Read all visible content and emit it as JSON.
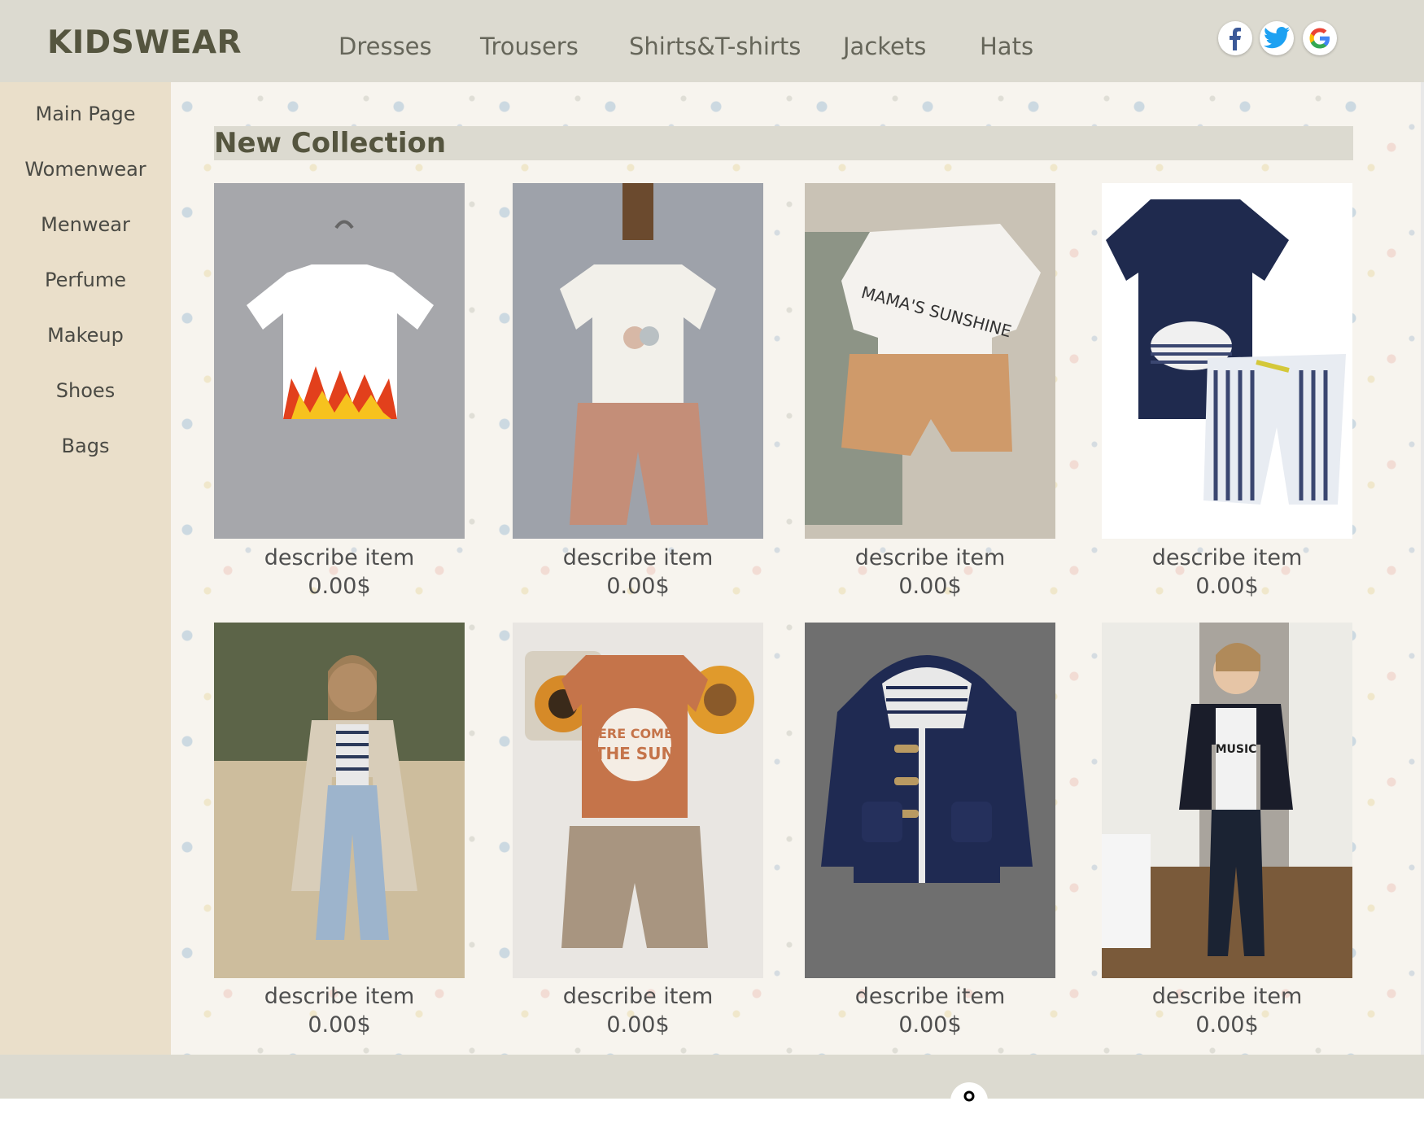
{
  "brand": "KIDSWEAR",
  "nav": [
    "Dresses",
    "Trousers",
    "Shirts&T-shirts",
    "Jackets",
    "Hats"
  ],
  "social": [
    {
      "icon": "facebook-icon",
      "glyph": "f",
      "color": "#3b5998"
    },
    {
      "icon": "twitter-icon",
      "glyph": "t",
      "color": "#1da1f2"
    },
    {
      "icon": "google-icon",
      "glyph": "G",
      "color": "#4285f4"
    }
  ],
  "sidebar": [
    "Main Page",
    "Womenwear",
    "Menwear",
    "Perfume",
    "Makeup",
    "Shoes",
    "Bags"
  ],
  "section_title": "New Collection",
  "products": [
    {
      "desc": "describe item",
      "price": "0.00$"
    },
    {
      "desc": "describe item",
      "price": "0.00$"
    },
    {
      "desc": "describe item",
      "price": "0.00$"
    },
    {
      "desc": "describe item",
      "price": "0.00$"
    },
    {
      "desc": "describe item",
      "price": "0.00$"
    },
    {
      "desc": "describe item",
      "price": "0.00$"
    },
    {
      "desc": "describe item",
      "price": "0.00$"
    },
    {
      "desc": "describe item",
      "price": "0.00$"
    }
  ],
  "product_images": [
    {
      "name": "flame-crop-tee-photo",
      "bg": "#a6a7ab",
      "garment": "#ffffff",
      "accent": "#e2401c"
    },
    {
      "name": "tee-and-shorts-set-photo",
      "bg": "#9ea2aa",
      "garment": "#f2f0ea",
      "accent": "#c48e78"
    },
    {
      "name": "mamas-sunshine-outfit-photo",
      "bg": "#c9c2b5",
      "garment": "#f4f2ee",
      "accent": "#cf9a6a"
    },
    {
      "name": "whale-tee-shorts-photo",
      "bg": "#ffffff",
      "garment": "#1f2a4e",
      "accent": "#3a4670"
    },
    {
      "name": "girl-trench-coat-photo",
      "bg": "#b7ab95",
      "garment": "#d8cdb9",
      "accent": "#9db4cc"
    },
    {
      "name": "here-comes-the-sun-outfit-photo",
      "bg": "#e9e6e2",
      "garment": "#c5744a",
      "accent": "#a89580"
    },
    {
      "name": "navy-duffle-coat-photo",
      "bg": "#6f6f6f",
      "garment": "#1f2a52",
      "accent": "#b99a62"
    },
    {
      "name": "boy-blazer-photo",
      "bg": "#a9a49d",
      "garment": "#1a1d2a",
      "accent": "#f2f2f2"
    }
  ]
}
